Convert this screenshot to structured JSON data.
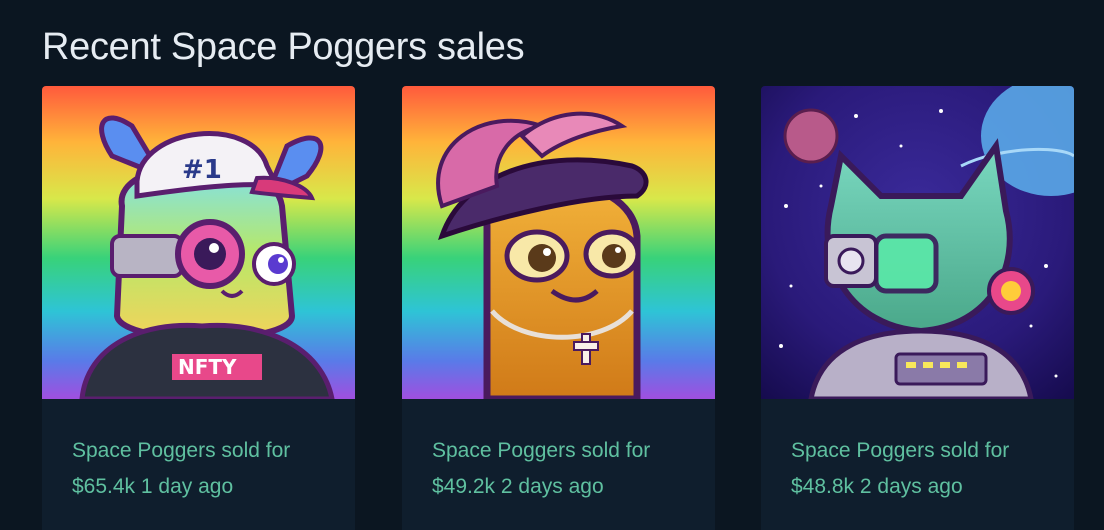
{
  "section": {
    "title": "Recent Space Poggers sales"
  },
  "sales": [
    {
      "line1": "Space Poggers sold for",
      "line2": "$65.4k 1 day ago",
      "image_name": "rainbow-llama-poggers-image",
      "image_label": "NFTY",
      "cap_label": "#1"
    },
    {
      "line1": "Space Poggers sold for",
      "line2": "$49.2k 2 days ago",
      "image_name": "rainbow-pickle-pirate-image"
    },
    {
      "line1": "Space Poggers sold for",
      "line2": "$48.8k 2 days ago",
      "image_name": "space-cat-cyborg-image"
    }
  ],
  "colors": {
    "background": "#0b1621",
    "card": "#0f1e2d",
    "accent_text": "#5fc0a0",
    "title": "#e6ecf2"
  }
}
